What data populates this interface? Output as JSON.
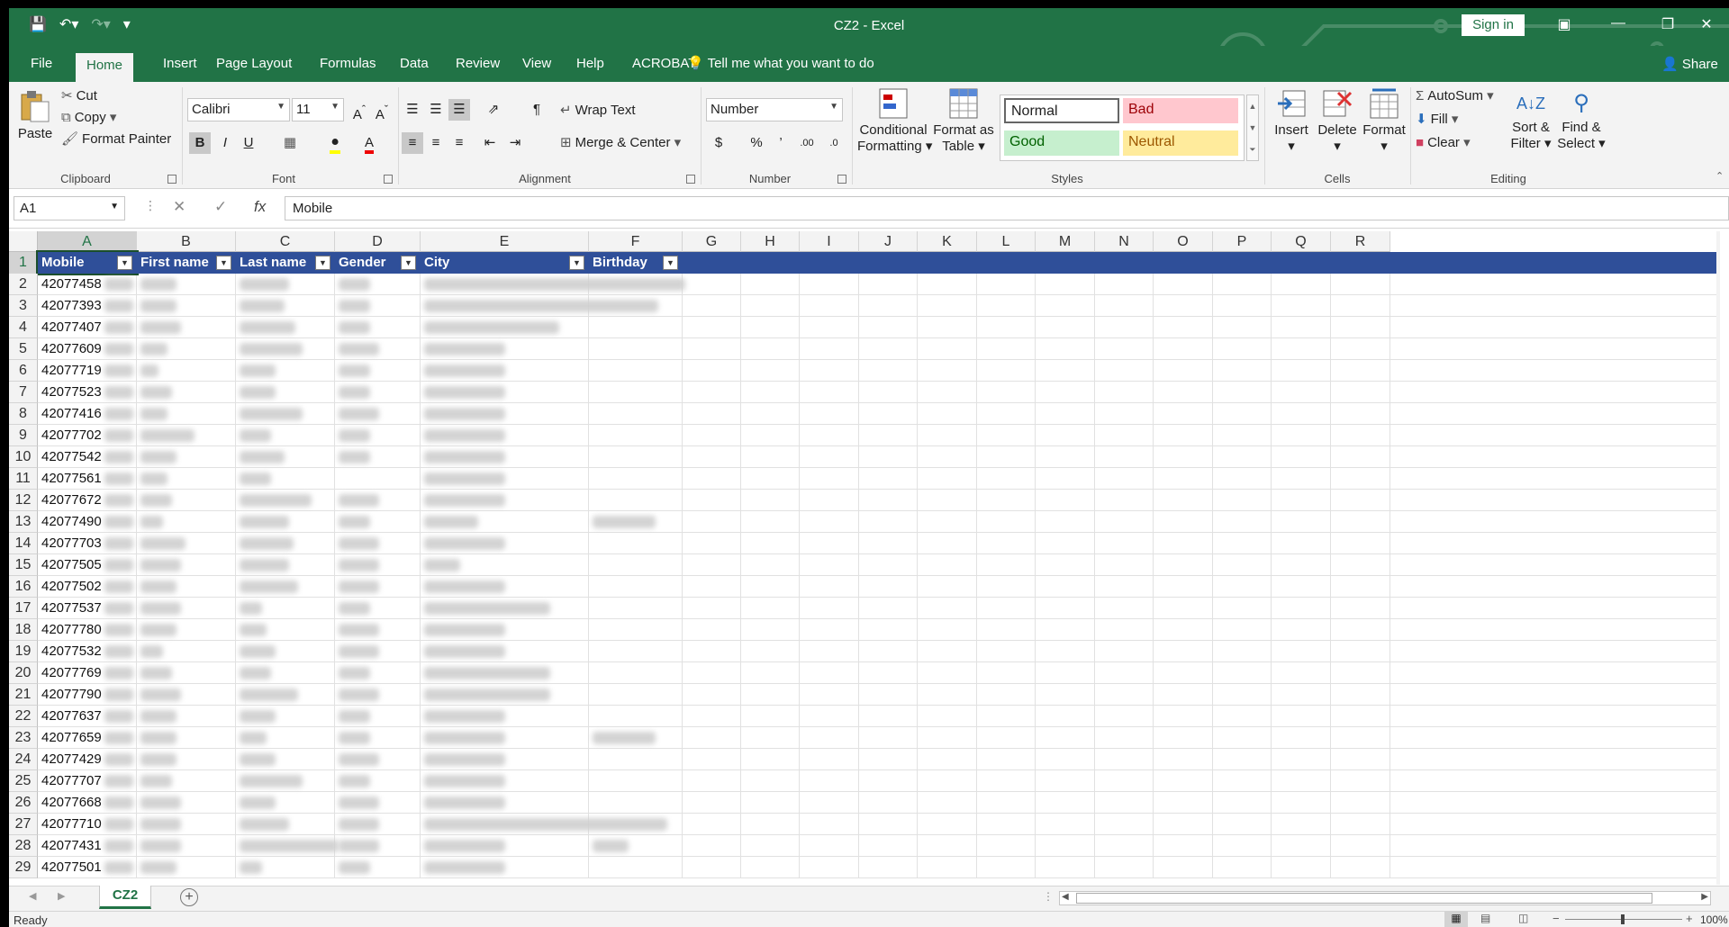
{
  "window": {
    "title": "CZ2  -  Excel",
    "sign_in": "Sign in"
  },
  "tabs": [
    "File",
    "Home",
    "Insert",
    "Page Layout",
    "Formulas",
    "Data",
    "Review",
    "View",
    "Help",
    "ACROBAT"
  ],
  "tell_me": "Tell me what you want to do",
  "share": "Share",
  "ribbon": {
    "clipboard": {
      "paste": "Paste",
      "cut": "Cut",
      "copy": "Copy",
      "format_painter": "Format Painter",
      "label": "Clipboard"
    },
    "font": {
      "name": "Calibri",
      "size": "11",
      "label": "Font"
    },
    "alignment": {
      "wrap_text": "Wrap Text",
      "merge_center": "Merge & Center",
      "label": "Alignment"
    },
    "number": {
      "format": "Number",
      "label": "Number"
    },
    "styles": {
      "conditional_1": "Conditional",
      "conditional_2": "Formatting",
      "format_as_1": "Format as",
      "format_as_2": "Table",
      "normal": "Normal",
      "bad": "Bad",
      "good": "Good",
      "neutral": "Neutral",
      "label": "Styles"
    },
    "cells": {
      "insert": "Insert",
      "delete": "Delete",
      "format": "Format",
      "label": "Cells"
    },
    "editing": {
      "autosum": "AutoSum",
      "fill": "Fill",
      "clear": "Clear",
      "sort_1": "Sort &",
      "sort_2": "Filter",
      "find_1": "Find &",
      "find_2": "Select",
      "label": "Editing"
    }
  },
  "formula_bar": {
    "name_box": "A1",
    "formula": "Mobile"
  },
  "columns": [
    "A",
    "B",
    "C",
    "D",
    "E",
    "F",
    "G",
    "H",
    "I",
    "J",
    "K",
    "L",
    "M",
    "N",
    "O",
    "P",
    "Q",
    "R"
  ],
  "headers": [
    "Mobile",
    "First name",
    "Last name",
    "Gender",
    "City",
    "Birthday"
  ],
  "rows": [
    {
      "n": "1"
    },
    {
      "n": "2",
      "mobile": "42077458"
    },
    {
      "n": "3",
      "mobile": "42077393"
    },
    {
      "n": "4",
      "mobile": "42077407"
    },
    {
      "n": "5",
      "mobile": "42077609"
    },
    {
      "n": "6",
      "mobile": "42077719"
    },
    {
      "n": "7",
      "mobile": "42077523"
    },
    {
      "n": "8",
      "mobile": "42077416"
    },
    {
      "n": "9",
      "mobile": "42077702"
    },
    {
      "n": "10",
      "mobile": "42077542"
    },
    {
      "n": "11",
      "mobile": "42077561"
    },
    {
      "n": "12",
      "mobile": "42077672"
    },
    {
      "n": "13",
      "mobile": "42077490"
    },
    {
      "n": "14",
      "mobile": "42077703"
    },
    {
      "n": "15",
      "mobile": "42077505"
    },
    {
      "n": "16",
      "mobile": "42077502"
    },
    {
      "n": "17",
      "mobile": "42077537"
    },
    {
      "n": "18",
      "mobile": "42077780"
    },
    {
      "n": "19",
      "mobile": "42077532"
    },
    {
      "n": "20",
      "mobile": "42077769"
    },
    {
      "n": "21",
      "mobile": "42077790"
    },
    {
      "n": "22",
      "mobile": "42077637"
    },
    {
      "n": "23",
      "mobile": "42077659"
    },
    {
      "n": "24",
      "mobile": "42077429"
    },
    {
      "n": "25",
      "mobile": "42077707"
    },
    {
      "n": "26",
      "mobile": "42077668"
    },
    {
      "n": "27",
      "mobile": "42077710"
    },
    {
      "n": "28",
      "mobile": "42077431"
    },
    {
      "n": "29",
      "mobile": "42077501"
    }
  ],
  "sheet_tab": "CZ2",
  "status": "Ready",
  "zoom": "100%",
  "colors": {
    "excel_green": "#217346",
    "table_header": "#2f4f99",
    "bad_bg": "#ffc7ce",
    "good_bg": "#c6efce",
    "neutral_bg": "#ffeb9c"
  }
}
